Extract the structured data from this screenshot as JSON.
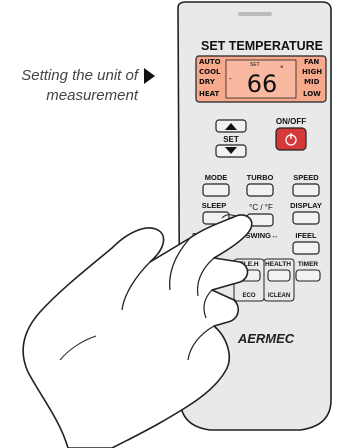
{
  "caption": {
    "line1": "Setting the unit of",
    "line2": "measurement"
  },
  "remote": {
    "title": "SET TEMPERATURE",
    "lcd": {
      "value": "66",
      "unit": "°",
      "small": "SET",
      "left_modes": [
        "AUTO",
        "COOL",
        "DRY",
        "HEAT"
      ],
      "right_modes": [
        "FAN",
        "HIGH",
        "MID",
        "LOW"
      ]
    },
    "buttons": {
      "set": "SET",
      "onoff": "ON/OFF",
      "mode": "MODE",
      "turbo": "TURBO",
      "speed": "SPEED",
      "sleep": "SLEEP",
      "cf": "°C / °F",
      "display": "DISPLAY",
      "swing_left": "SW",
      "swing": "SWING↔",
      "ifeel": "IFEEL",
      "eleh": "ELE.H",
      "health": "HEALTH",
      "timer": "TIMER",
      "eco": "ECO",
      "iclean": "ICLEAN"
    },
    "brand": "AERMEC"
  },
  "colors": {
    "remote_body": "#e9e9e9",
    "lcd_background": "#f7a98c",
    "lcd_text": "#111111",
    "onoff_button": "#d43a3a",
    "outline": "#222222"
  }
}
